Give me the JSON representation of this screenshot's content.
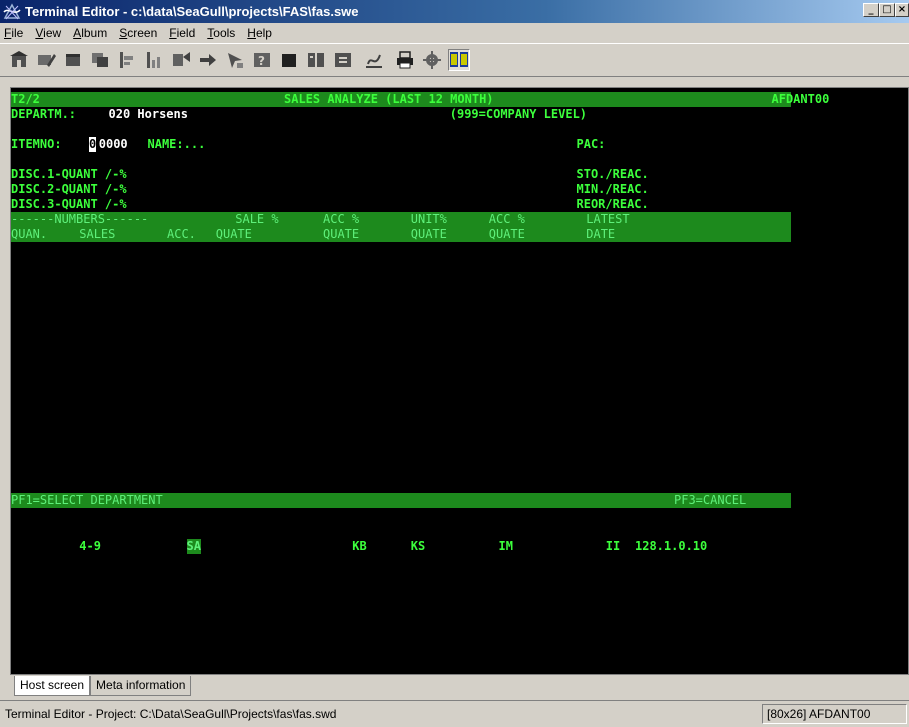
{
  "window": {
    "title": "Terminal Editor - c:\\data\\SeaGull\\projects\\FAS\\fas.swe",
    "minimize": "_",
    "maximize": "□",
    "close": "×"
  },
  "menu": [
    {
      "label": "File",
      "key": "F"
    },
    {
      "label": "View",
      "key": "V"
    },
    {
      "label": "Album",
      "key": "A"
    },
    {
      "label": "Screen",
      "key": "S"
    },
    {
      "label": "Field",
      "key": "F"
    },
    {
      "label": "Tools",
      "key": "T"
    },
    {
      "label": "Help",
      "key": "H"
    }
  ],
  "toolbar": [
    "building-icon",
    "edit-field-icon",
    "block-icon",
    "copy-field-icon",
    "align-left-icon",
    "align-bottom-icon",
    "wizard-icon",
    "move-icon",
    "cursor-icon",
    "properties-icon",
    "black-box-icon",
    "split-icon",
    "join-icon",
    "sign-icon",
    "print-icon",
    "gear-icon",
    "tile-icon"
  ],
  "terminal": {
    "rows": [
      {
        "type": "band",
        "segments": [
          [
            "T2/2",
            0
          ],
          [
            "SALES ANALYZE (LAST 12 MONTH)",
            28
          ],
          [
            "AFDANT00",
            78
          ]
        ]
      },
      {
        "type": "plain",
        "segments": [
          [
            "DEPARTM.:",
            0,
            "label"
          ],
          [
            "020 Horsens",
            10,
            "value"
          ],
          [
            "(999=COMPANY LEVEL)",
            45,
            "label"
          ]
        ]
      },
      {
        "type": "empty"
      },
      {
        "type": "plain",
        "segments": [
          [
            "ITEMNO:",
            0,
            "label"
          ],
          [
            "0",
            8,
            "cursor"
          ],
          [
            "0000",
            9,
            "value"
          ],
          [
            "NAME:...",
            14,
            "label"
          ],
          [
            "PAC:",
            58,
            "label"
          ]
        ]
      },
      {
        "type": "empty"
      },
      {
        "type": "plain",
        "segments": [
          [
            "DISC.1-QUANT /-%",
            0,
            "label"
          ],
          [
            "STO./REAC.",
            58,
            "label"
          ]
        ]
      },
      {
        "type": "plain",
        "segments": [
          [
            "DISC.2-QUANT /-%",
            0,
            "label"
          ],
          [
            "MIN./REAC.",
            58,
            "label"
          ]
        ]
      },
      {
        "type": "plain",
        "segments": [
          [
            "DISC.3-QUANT /-%",
            0,
            "label"
          ],
          [
            "REOR/REAC.",
            58,
            "label"
          ]
        ]
      },
      {
        "type": "band-light",
        "segments": [
          [
            "------NUMBERS------",
            0
          ],
          [
            "SALE %",
            23
          ],
          [
            "ACC %",
            32
          ],
          [
            "UNIT%",
            41
          ],
          [
            "ACC %",
            49
          ],
          [
            "LATEST",
            59
          ]
        ]
      },
      {
        "type": "band-light",
        "segments": [
          [
            "QUAN.",
            0
          ],
          [
            "SALES",
            7
          ],
          [
            "ACC.",
            16
          ],
          [
            "QUATE",
            21
          ],
          [
            "QUATE",
            32
          ],
          [
            "QUATE",
            41
          ],
          [
            "QUATE",
            49
          ],
          [
            "DATE",
            59
          ]
        ]
      }
    ],
    "footer": {
      "left": "PF1=SELECT DEPARTMENT",
      "right": "PF3=CANCEL"
    },
    "status_line": [
      {
        "text": "4-9",
        "col": 7,
        "style": "label"
      },
      {
        "text": "SA",
        "col": 18,
        "style": "hl"
      },
      {
        "text": "KB",
        "col": 35,
        "style": "label"
      },
      {
        "text": "KS",
        "col": 41,
        "style": "label"
      },
      {
        "text": "IM",
        "col": 50,
        "style": "label"
      },
      {
        "text": "II",
        "col": 61,
        "style": "label"
      },
      {
        "text": "128.1.0.10",
        "col": 64,
        "style": "label"
      }
    ]
  },
  "tabs": [
    {
      "label": "Host screen",
      "active": true
    },
    {
      "label": "Meta information",
      "active": false
    }
  ],
  "status": {
    "left": "Terminal Editor - Project: C:\\Data\\SeaGull\\Projects\\fas\\fas.swd",
    "right": "[80x26] AFDANT00"
  },
  "colors": {
    "terminal_bg": "#000000",
    "terminal_text": "#3cff3c",
    "band_bg": "#1d8a1d",
    "value_text": "#ffffff"
  }
}
